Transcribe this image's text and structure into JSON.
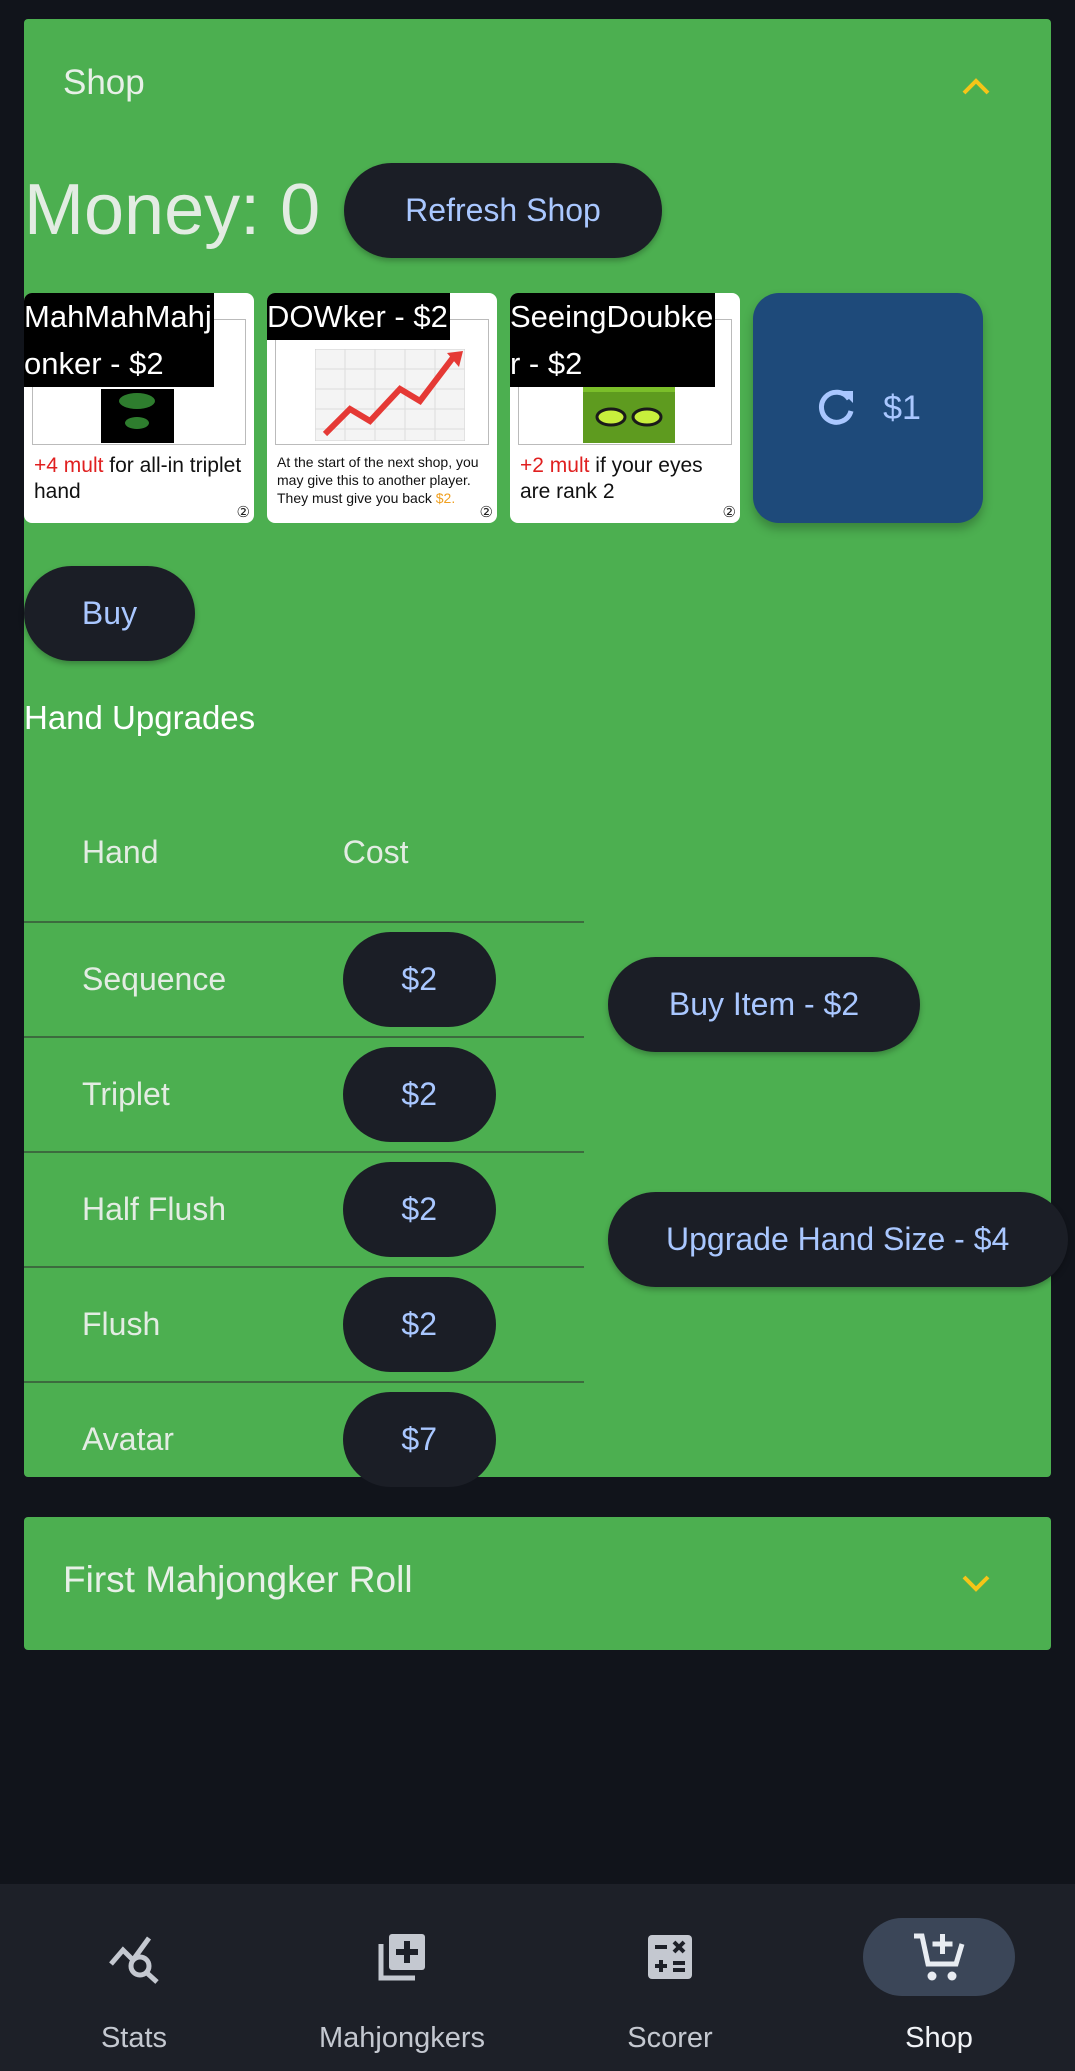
{
  "shop": {
    "title": "Shop",
    "money_label": "Money: 0",
    "refresh_label": "Refresh Shop",
    "cards": [
      {
        "title_line1": "MahMahMahj",
        "title_line2": "onker - $2",
        "desc_highlight": "+4 mult",
        "desc_rest": " for all-in triplet hand",
        "badge": "②"
      },
      {
        "title_line1": "DOWker - $2",
        "title_line2": "",
        "desc_line1": "At the start of the next shop, you may give this to another player.",
        "desc_line2": "They must give you back ",
        "desc_money": "$2.",
        "badge": "②"
      },
      {
        "title_line1": "SeeingDoubke",
        "title_line2": "r - $2",
        "desc_highlight": "+2 mult",
        "desc_rest": " if your eyes are rank 2",
        "badge": "②"
      }
    ],
    "reroll_price": "$1",
    "buy_label": "Buy",
    "hand_upgrades_title": "Hand Upgrades",
    "table": {
      "headers": [
        "Hand",
        "Cost"
      ],
      "rows": [
        {
          "hand": "Sequence",
          "cost": "$2"
        },
        {
          "hand": "Triplet",
          "cost": "$2"
        },
        {
          "hand": "Half Flush",
          "cost": "$2"
        },
        {
          "hand": "Flush",
          "cost": "$2"
        },
        {
          "hand": "Avatar",
          "cost": "$7"
        }
      ]
    },
    "buy_item_label": "Buy Item - $2",
    "upgrade_hand_label": "Upgrade Hand Size - $4"
  },
  "roll": {
    "title": "First Mahjongker Roll"
  },
  "nav": {
    "items": [
      {
        "label": "Stats",
        "icon": "stats-search-icon"
      },
      {
        "label": "Mahjongkers",
        "icon": "library-add-icon"
      },
      {
        "label": "Scorer",
        "icon": "calculator-icon"
      },
      {
        "label": "Shop",
        "icon": "cart-add-icon"
      }
    ]
  },
  "colors": {
    "panel_green": "#4caf50",
    "pill_dark": "#1b1e26",
    "pill_text": "#a9c7ff",
    "accent_chevron": "#f5c518",
    "reroll_blue": "#1e4a7a"
  }
}
